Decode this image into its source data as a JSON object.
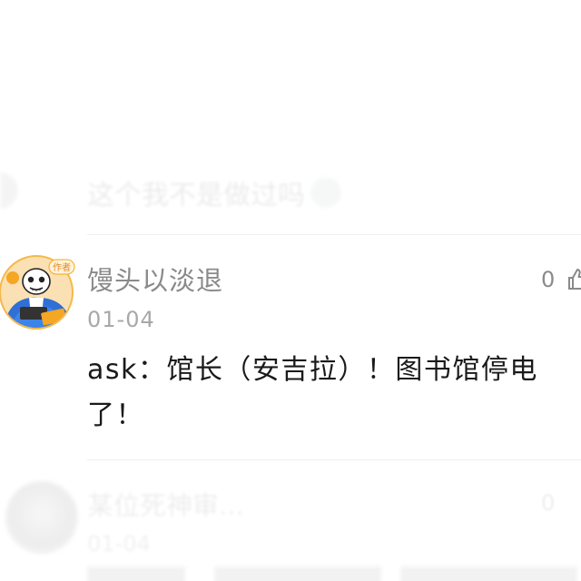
{
  "previous_comment": {
    "text": "这个我不是做过吗",
    "emoji_icon": "smiley-icon"
  },
  "comment": {
    "username": "馒头以淡退",
    "avatar_badge": "作者",
    "date": "01-04",
    "like_count": "0",
    "like_icon": "thumbs-up-icon",
    "body_line1": "ask：馆长（安吉拉）！图书馆停电",
    "body_line2": "了！"
  },
  "next_comment": {
    "username": "某位死神审...",
    "like_count": "0",
    "date": "01-04"
  }
}
